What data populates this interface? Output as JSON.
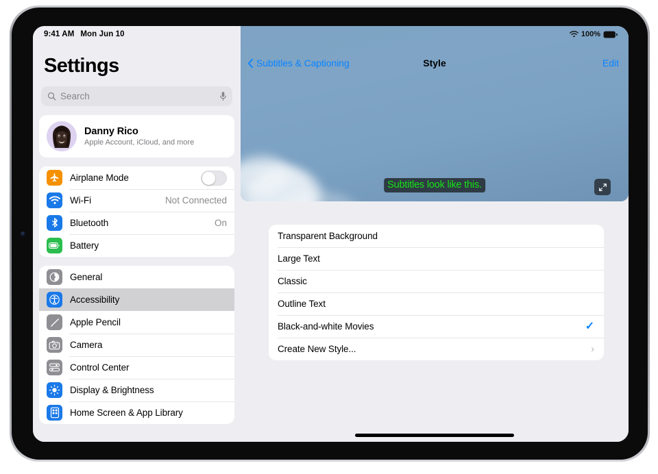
{
  "device": {
    "camera_icon": "front-camera-icon"
  },
  "status_bar": {
    "time": "9:41 AM",
    "date": "Mon Jun 10",
    "wifi_icon": "wifi-icon",
    "battery_percent": "100%",
    "battery_icon": "battery-full-icon"
  },
  "sidebar": {
    "title": "Settings",
    "search": {
      "placeholder": "Search",
      "value": "",
      "search_icon": "search-icon",
      "mic_icon": "microphone-icon"
    },
    "account": {
      "name": "Danny Rico",
      "subtitle": "Apple Account, iCloud, and more",
      "avatar_icon": "memoji-avatar"
    },
    "connectivity_group": [
      {
        "label": "Airplane Mode",
        "icon": "airplane-icon",
        "icon_color": "#f59000",
        "control": "toggle",
        "toggle_on": false,
        "value": ""
      },
      {
        "label": "Wi-Fi",
        "icon": "wifi-icon",
        "icon_color": "#1a79e8",
        "control": "value",
        "value": "Not Connected"
      },
      {
        "label": "Bluetooth",
        "icon": "bluetooth-icon",
        "icon_color": "#1a79e8",
        "control": "value",
        "value": "On"
      },
      {
        "label": "Battery",
        "icon": "battery-icon",
        "icon_color": "#2bbd4e",
        "control": "none",
        "value": ""
      }
    ],
    "settings_group": [
      {
        "label": "General",
        "icon": "gear-icon",
        "icon_color": "#8e8e93",
        "selected": false
      },
      {
        "label": "Accessibility",
        "icon": "accessibility-icon",
        "icon_color": "#1a79e8",
        "selected": true
      },
      {
        "label": "Apple Pencil",
        "icon": "pencil-icon",
        "icon_color": "#8e8e93",
        "selected": false
      },
      {
        "label": "Camera",
        "icon": "camera-icon",
        "icon_color": "#8e8e93",
        "selected": false
      },
      {
        "label": "Control Center",
        "icon": "control-center-icon",
        "icon_color": "#8e8e93",
        "selected": false
      },
      {
        "label": "Display & Brightness",
        "icon": "brightness-icon",
        "icon_color": "#1a79e8",
        "selected": false
      },
      {
        "label": "Home Screen & App Library",
        "icon": "home-screen-icon",
        "icon_color": "#1a79e8",
        "selected": false
      }
    ]
  },
  "detail": {
    "nav": {
      "back_label": "Subtitles & Captioning",
      "back_icon": "chevron-left-icon",
      "title": "Style",
      "edit_label": "Edit"
    },
    "preview": {
      "subtitle_text": "Subtitles look like this.",
      "subtitle_text_color": "#15e315",
      "subtitle_background_color": "#2f3b44",
      "expand_icon": "expand-diagonal-icon",
      "background_description": "blue sky with wispy clouds"
    },
    "style_options": [
      {
        "label": "Transparent Background",
        "checked": false,
        "has_chevron": false
      },
      {
        "label": "Large Text",
        "checked": false,
        "has_chevron": false
      },
      {
        "label": "Classic",
        "checked": false,
        "has_chevron": false
      },
      {
        "label": "Outline Text",
        "checked": false,
        "has_chevron": false
      },
      {
        "label": "Black-and-white Movies",
        "checked": true,
        "has_chevron": false
      },
      {
        "label": "Create New Style...",
        "checked": false,
        "has_chevron": true
      }
    ],
    "checkmark_glyph": "✓",
    "chevron_glyph": "›",
    "accent_color": "#0a84ff"
  }
}
